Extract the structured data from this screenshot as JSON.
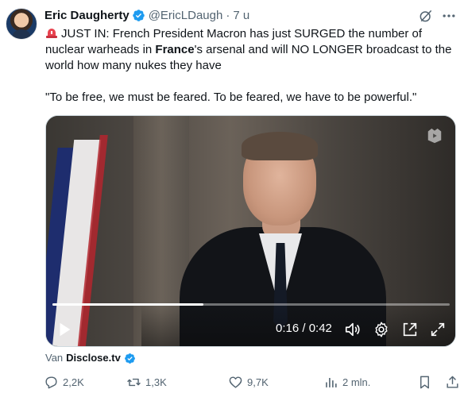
{
  "author": {
    "name": "Eric Daugherty",
    "handle": "@EricLDaugh",
    "separator": "·",
    "time": "7 u"
  },
  "icons": {
    "verified": "verified-badge-icon",
    "grok": "grok-icon",
    "more": "more-horizontal-icon",
    "siren": "siren-emoji-icon"
  },
  "tweet": {
    "text_part1": "JUST IN: French President Macron has just SURGED the number of nuclear warheads in ",
    "text_bold": "France",
    "text_part2": "'s arsenal and will NO LONGER broadcast to the world how many nukes they have",
    "quote": "\"To be free, we must be feared. To be feared, we have to be powerful.\""
  },
  "video": {
    "time_display": "0:16 / 0:42",
    "progress_fraction": 0.38
  },
  "source": {
    "prefix": "Van",
    "name": "Disclose.tv"
  },
  "actions": {
    "replies": "2,2K",
    "reposts": "1,3K",
    "likes": "9,7K",
    "views": "2 mln."
  },
  "colors": {
    "verified_blue": "#1d9bf0",
    "secondary_text": "#536471",
    "primary_text": "#0f1419"
  }
}
